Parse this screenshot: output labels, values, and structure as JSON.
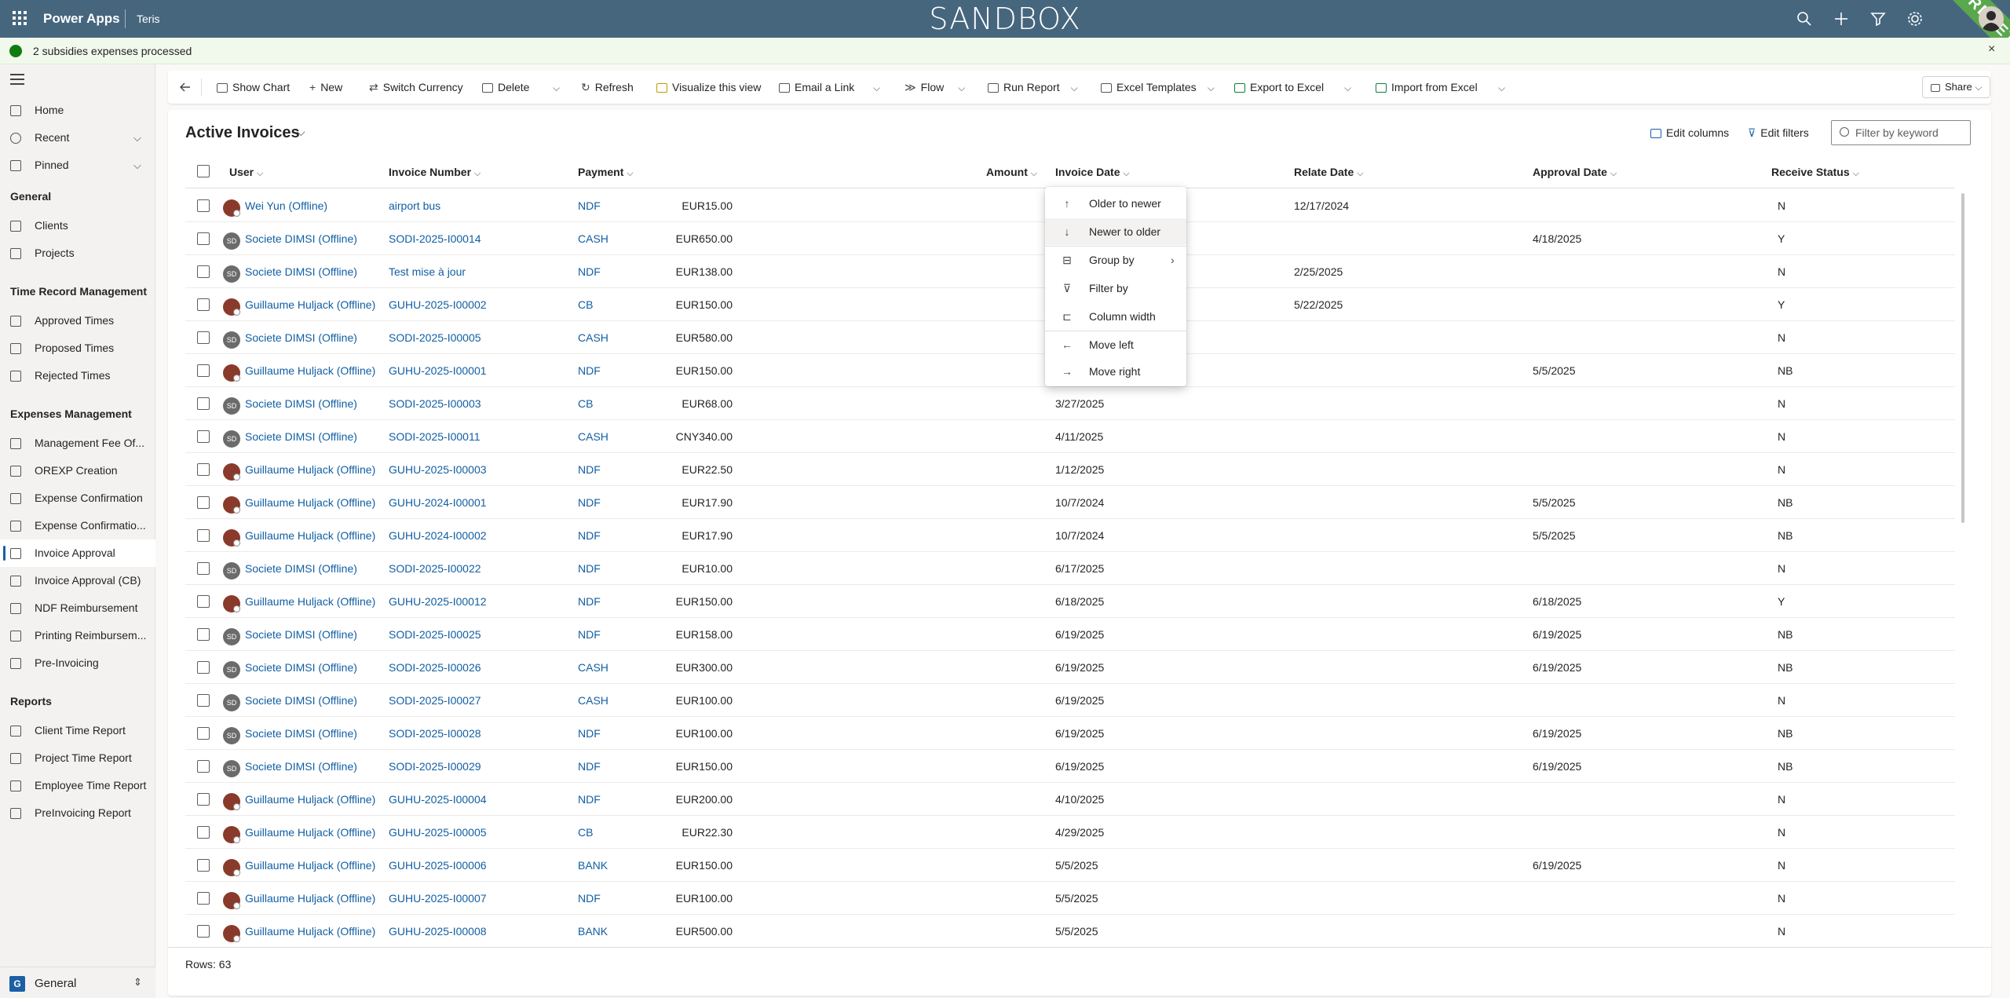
{
  "topbar": {
    "app_name": "Power Apps",
    "env_name": "Teris",
    "banner": "SANDBOX",
    "ribbon": "RECETTE",
    "icons": [
      "search-icon",
      "add-icon",
      "filter-icon",
      "settings-icon",
      "help-icon"
    ]
  },
  "notification": {
    "text": "2 subsidies expenses processed",
    "close": "×"
  },
  "sidebar": {
    "top_items": [
      {
        "label": "Home",
        "icon": "home-icon"
      },
      {
        "label": "Recent",
        "icon": "clock-icon",
        "chevron": "⌵"
      },
      {
        "label": "Pinned",
        "icon": "pin-icon",
        "chevron": "⌵"
      }
    ],
    "groups": [
      {
        "title": "General",
        "items": [
          "Clients",
          "Projects"
        ]
      },
      {
        "title": "Time Record Management",
        "items": [
          "Approved Times",
          "Proposed Times",
          "Rejected Times"
        ]
      },
      {
        "title": "Expenses Management",
        "items": [
          "Management Fee Of...",
          "OREXP Creation",
          "Expense Confirmation",
          "Expense Confirmatio...",
          "Invoice Approval",
          "Invoice Approval (CB)",
          "NDF Reimbursement",
          "Printing Reimbursem...",
          "Pre-Invoicing"
        ]
      },
      {
        "title": "Reports",
        "items": [
          "Client Time Report",
          "Project Time Report",
          "Employee Time Report",
          "PreInvoicing Report"
        ]
      }
    ],
    "active": "Invoice Approval",
    "area": {
      "badge": "G",
      "label": "General",
      "chevron": "⇕"
    }
  },
  "commands": [
    "Show Chart",
    "New",
    "Switch Currency",
    "Delete",
    "Refresh",
    "Visualize this view",
    "Email a Link",
    "Flow",
    "Run Report",
    "Excel Templates",
    "Export to Excel",
    "Import from Excel",
    "Share"
  ],
  "view": {
    "title": "Active Invoices",
    "chevron": "⌵",
    "edit_columns": "Edit columns",
    "edit_filters": "Edit filters",
    "filter_placeholder": "Filter by keyword"
  },
  "columns": [
    "User",
    "Invoice Number",
    "Payment",
    "Amount",
    "Invoice Date",
    "Relate Date",
    "Approval Date",
    "Receive Status"
  ],
  "rows": [
    {
      "user": "Wei Yun (Offline)",
      "av": "photo",
      "inv": "airport bus",
      "pay": "NDF",
      "amt": "EUR15.00",
      "idate": "",
      "rdate": "12/17/2024",
      "adate": "",
      "rs": "N"
    },
    {
      "user": "Societe DIMSI (Offline)",
      "av": "SD",
      "inv": "SODI-2025-I00014",
      "pay": "CASH",
      "amt": "EUR650.00",
      "idate": "",
      "rdate": "",
      "adate": "4/18/2025",
      "rs": "Y"
    },
    {
      "user": "Societe DIMSI (Offline)",
      "av": "SD",
      "inv": "Test mise à jour",
      "pay": "NDF",
      "amt": "EUR138.00",
      "idate": "",
      "rdate": "2/25/2025",
      "adate": "",
      "rs": "N"
    },
    {
      "user": "Guillaume Huljack (Offline)",
      "av": "photo",
      "inv": "GUHU-2025-I00002",
      "pay": "CB",
      "amt": "EUR150.00",
      "idate": "",
      "rdate": "5/22/2025",
      "adate": "",
      "rs": "Y"
    },
    {
      "user": "Societe DIMSI (Offline)",
      "av": "SD",
      "inv": "SODI-2025-I00005",
      "pay": "CASH",
      "amt": "EUR580.00",
      "idate": "",
      "rdate": "",
      "adate": "",
      "rs": "N"
    },
    {
      "user": "Guillaume Huljack (Offline)",
      "av": "photo",
      "inv": "GUHU-2025-I00001",
      "pay": "NDF",
      "amt": "EUR150.00",
      "idate": "",
      "rdate": "",
      "adate": "5/5/2025",
      "rs": "NB"
    },
    {
      "user": "Societe DIMSI (Offline)",
      "av": "SD",
      "inv": "SODI-2025-I00003",
      "pay": "CB",
      "amt": "EUR68.00",
      "idate": "3/27/2025",
      "rdate": "",
      "adate": "",
      "rs": "N"
    },
    {
      "user": "Societe DIMSI (Offline)",
      "av": "SD",
      "inv": "SODI-2025-I00011",
      "pay": "CASH",
      "amt": "CNY340.00",
      "idate": "4/11/2025",
      "rdate": "",
      "adate": "",
      "rs": "N"
    },
    {
      "user": "Guillaume Huljack (Offline)",
      "av": "photo",
      "inv": "GUHU-2025-I00003",
      "pay": "NDF",
      "amt": "EUR22.50",
      "idate": "1/12/2025",
      "rdate": "",
      "adate": "",
      "rs": "N"
    },
    {
      "user": "Guillaume Huljack (Offline)",
      "av": "photo",
      "inv": "GUHU-2024-I00001",
      "pay": "NDF",
      "amt": "EUR17.90",
      "idate": "10/7/2024",
      "rdate": "",
      "adate": "5/5/2025",
      "rs": "NB"
    },
    {
      "user": "Guillaume Huljack (Offline)",
      "av": "photo",
      "inv": "GUHU-2024-I00002",
      "pay": "NDF",
      "amt": "EUR17.90",
      "idate": "10/7/2024",
      "rdate": "",
      "adate": "5/5/2025",
      "rs": "NB"
    },
    {
      "user": "Societe DIMSI (Offline)",
      "av": "SD",
      "inv": "SODI-2025-I00022",
      "pay": "NDF",
      "amt": "EUR10.00",
      "idate": "6/17/2025",
      "rdate": "",
      "adate": "",
      "rs": "N"
    },
    {
      "user": "Guillaume Huljack (Offline)",
      "av": "photo",
      "inv": "GUHU-2025-I00012",
      "pay": "NDF",
      "amt": "EUR150.00",
      "idate": "6/18/2025",
      "rdate": "",
      "adate": "6/18/2025",
      "rs": "Y"
    },
    {
      "user": "Societe DIMSI (Offline)",
      "av": "SD",
      "inv": "SODI-2025-I00025",
      "pay": "NDF",
      "amt": "EUR158.00",
      "idate": "6/19/2025",
      "rdate": "",
      "adate": "6/19/2025",
      "rs": "NB"
    },
    {
      "user": "Societe DIMSI (Offline)",
      "av": "SD",
      "inv": "SODI-2025-I00026",
      "pay": "CASH",
      "amt": "EUR300.00",
      "idate": "6/19/2025",
      "rdate": "",
      "adate": "6/19/2025",
      "rs": "NB"
    },
    {
      "user": "Societe DIMSI (Offline)",
      "av": "SD",
      "inv": "SODI-2025-I00027",
      "pay": "CASH",
      "amt": "EUR100.00",
      "idate": "6/19/2025",
      "rdate": "",
      "adate": "",
      "rs": "N"
    },
    {
      "user": "Societe DIMSI (Offline)",
      "av": "SD",
      "inv": "SODI-2025-I00028",
      "pay": "NDF",
      "amt": "EUR100.00",
      "idate": "6/19/2025",
      "rdate": "",
      "adate": "6/19/2025",
      "rs": "NB"
    },
    {
      "user": "Societe DIMSI (Offline)",
      "av": "SD",
      "inv": "SODI-2025-I00029",
      "pay": "NDF",
      "amt": "EUR150.00",
      "idate": "6/19/2025",
      "rdate": "",
      "adate": "6/19/2025",
      "rs": "NB"
    },
    {
      "user": "Guillaume Huljack (Offline)",
      "av": "photo",
      "inv": "GUHU-2025-I00004",
      "pay": "NDF",
      "amt": "EUR200.00",
      "idate": "4/10/2025",
      "rdate": "",
      "adate": "",
      "rs": "N"
    },
    {
      "user": "Guillaume Huljack (Offline)",
      "av": "photo",
      "inv": "GUHU-2025-I00005",
      "pay": "CB",
      "amt": "EUR22.30",
      "idate": "4/29/2025",
      "rdate": "",
      "adate": "",
      "rs": "N"
    },
    {
      "user": "Guillaume Huljack (Offline)",
      "av": "photo",
      "inv": "GUHU-2025-I00006",
      "pay": "BANK",
      "amt": "EUR150.00",
      "idate": "5/5/2025",
      "rdate": "",
      "adate": "6/19/2025",
      "rs": "N"
    },
    {
      "user": "Guillaume Huljack (Offline)",
      "av": "photo",
      "inv": "GUHU-2025-I00007",
      "pay": "NDF",
      "amt": "EUR100.00",
      "idate": "5/5/2025",
      "rdate": "",
      "adate": "",
      "rs": "N"
    },
    {
      "user": "Guillaume Huljack (Offline)",
      "av": "photo",
      "inv": "GUHU-2025-I00008",
      "pay": "BANK",
      "amt": "EUR500.00",
      "idate": "5/5/2025",
      "rdate": "",
      "adate": "",
      "rs": "N"
    }
  ],
  "column_menu": {
    "items": [
      {
        "label": "Older to newer",
        "icon": "↑"
      },
      {
        "label": "Newer to older",
        "icon": "↓",
        "highlighted": true
      },
      {
        "label": "Group by",
        "icon": "⊟",
        "submenu": "›"
      },
      {
        "label": "Filter by",
        "icon": "⊽"
      },
      {
        "label": "Column width",
        "icon": "⊏"
      },
      {
        "label": "Move left",
        "icon": "←"
      },
      {
        "label": "Move right",
        "icon": "→"
      }
    ]
  },
  "footer": {
    "rows": "Rows: 63"
  }
}
